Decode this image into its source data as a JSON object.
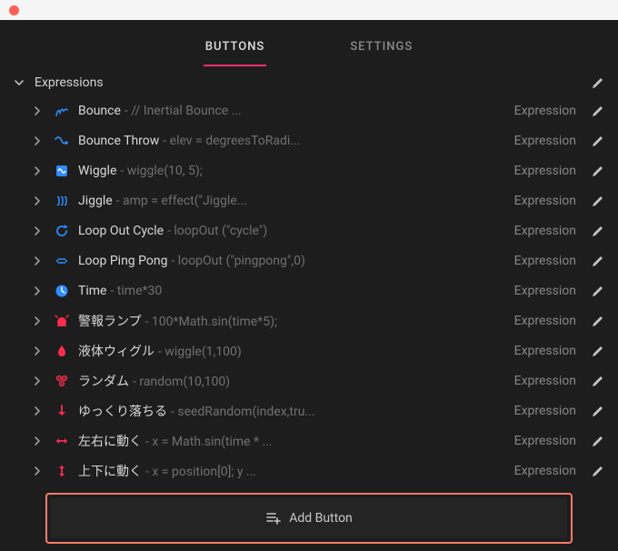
{
  "tabs": {
    "buttons": "BUTTONS",
    "settings": "SETTINGS",
    "active": "buttons"
  },
  "section": {
    "title": "Expressions"
  },
  "type_label": "Expression",
  "add_label": "Add Button",
  "items": [
    {
      "icon": "bounce",
      "color": "#2e8cff",
      "name": "Bounce",
      "desc": "- // Inertial Bounce ..."
    },
    {
      "icon": "bouncethrow",
      "color": "#2e8cff",
      "name": "Bounce Throw",
      "desc": "- elev = degreesToRadi..."
    },
    {
      "icon": "wiggle",
      "color": "#2e8cff",
      "name": "Wiggle",
      "desc": "- wiggle(10, 5);"
    },
    {
      "icon": "jiggle",
      "color": "#2e8cff",
      "name": "Jiggle",
      "desc": "- amp = effect(\"Jiggle..."
    },
    {
      "icon": "loopcycle",
      "color": "#2e8cff",
      "name": "Loop Out Cycle",
      "desc": "- loopOut (\"cycle\")"
    },
    {
      "icon": "loopping",
      "color": "#2e8cff",
      "name": "Loop Ping Pong",
      "desc": "- loopOut (\"pingpong\",0)"
    },
    {
      "icon": "time",
      "color": "#2e8cff",
      "name": "Time",
      "desc": "- time*30"
    },
    {
      "icon": "alarm",
      "color": "#ff2d4d",
      "name": "警報ランプ",
      "desc": "- 100*Math.sin(time*5);"
    },
    {
      "icon": "liquid",
      "color": "#ff2d4d",
      "name": "液体ウィグル",
      "desc": "- wiggle(1,100)"
    },
    {
      "icon": "random",
      "color": "#ff2d4d",
      "name": "ランダム",
      "desc": "- random(10,100)"
    },
    {
      "icon": "fall",
      "color": "#ff2d4d",
      "name": "ゆっくり落ちる",
      "desc": "- seedRandom(index,tru..."
    },
    {
      "icon": "horiz",
      "color": "#ff2d4d",
      "name": "左右に動く",
      "desc": "- x = Math.sin(time * ..."
    },
    {
      "icon": "vert",
      "color": "#ff2d4d",
      "name": "上下に動く",
      "desc": "- x = position[0]; y ..."
    }
  ]
}
